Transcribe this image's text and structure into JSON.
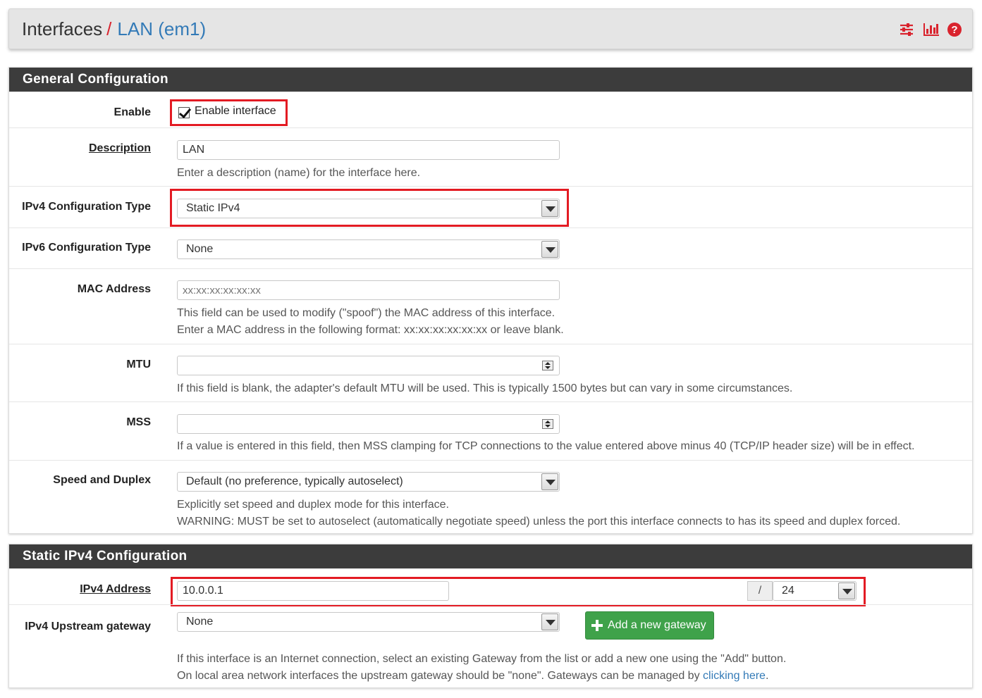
{
  "breadcrumb": {
    "root": "Interfaces",
    "separator": "/",
    "current": "LAN (em1)"
  },
  "header_icons": [
    "sliders-icon",
    "bar-chart-icon",
    "help-icon"
  ],
  "colors": {
    "accent_red": "#e31b23",
    "link_blue": "#337ab7",
    "panel_heading": "#3c3c3c",
    "button_green": "#3fa24a"
  },
  "general": {
    "title": "General Configuration",
    "enable": {
      "label": "Enable",
      "checkbox_label": "Enable interface",
      "checked": true
    },
    "description": {
      "label": "Description",
      "value": "LAN",
      "help": "Enter a description (name) for the interface here."
    },
    "ipv4_type": {
      "label": "IPv4 Configuration Type",
      "value": "Static IPv4"
    },
    "ipv6_type": {
      "label": "IPv6 Configuration Type",
      "value": "None"
    },
    "mac": {
      "label": "MAC Address",
      "placeholder": "xx:xx:xx:xx:xx:xx",
      "help1": "This field can be used to modify (\"spoof\") the MAC address of this interface.",
      "help2": "Enter a MAC address in the following format: xx:xx:xx:xx:xx:xx or leave blank."
    },
    "mtu": {
      "label": "MTU",
      "value": "",
      "help": "If this field is blank, the adapter's default MTU will be used. This is typically 1500 bytes but can vary in some circumstances."
    },
    "mss": {
      "label": "MSS",
      "value": "",
      "help": "If a value is entered in this field, then MSS clamping for TCP connections to the value entered above minus 40 (TCP/IP header size) will be in effect."
    },
    "speed": {
      "label": "Speed and Duplex",
      "value": "Default (no preference, typically autoselect)",
      "help1": "Explicitly set speed and duplex mode for this interface.",
      "help2": "WARNING: MUST be set to autoselect (automatically negotiate speed) unless the port this interface connects to has its speed and duplex forced."
    }
  },
  "static_ipv4": {
    "title": "Static IPv4 Configuration",
    "address": {
      "label": "IPv4 Address",
      "value": "10.0.0.1",
      "slash": "/",
      "prefix": "24"
    },
    "gateway": {
      "label": "IPv4 Upstream gateway",
      "value": "None",
      "add_button": "Add a new gateway",
      "help1": "If this interface is an Internet connection, select an existing Gateway from the list or add a new one using the \"Add\" button.",
      "help2_prefix": "On local area network interfaces the upstream gateway should be \"none\". Gateways can be managed by ",
      "help2_link": "clicking here",
      "help2_suffix": "."
    }
  }
}
